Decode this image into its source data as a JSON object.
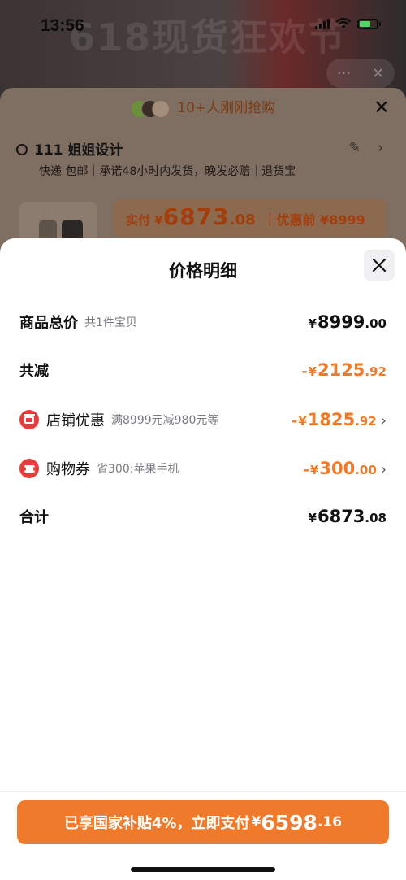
{
  "status_bar": {
    "time": "13:56"
  },
  "background": {
    "banner_text": "618现货狂欢节",
    "capsule_more": "···",
    "capsule_close": "✕",
    "grab_text": "10+人刚刚抢购",
    "close": "✕",
    "address": "111 姐姐设计",
    "delivery": "快递 包邮｜承诺48小时内发货，晚发必赔｜退货宝",
    "paid_label": "实付 ¥",
    "paid_amount": "6873",
    "paid_cents": ".08",
    "before_discount": "｜优惠前 ¥8999"
  },
  "sheet": {
    "title": "价格明细",
    "rows": {
      "total": {
        "label": "商品总价",
        "sub": "共1件宝贝",
        "currency": "¥",
        "amount": "8999",
        "cents": ".00"
      },
      "reduction": {
        "label": "共减",
        "sign": "-",
        "currency": "¥",
        "amount": "2125",
        "cents": ".92"
      },
      "store_discount": {
        "label": "店铺优惠",
        "sub": "满8999元减980元等",
        "sign": "-",
        "currency": "¥",
        "amount": "1825",
        "cents": ".92"
      },
      "shopping_coupon": {
        "label": "购物券",
        "sub": "省300:苹果手机",
        "sign": "-",
        "currency": "¥",
        "amount": "300",
        "cents": ".00"
      },
      "subtotal": {
        "label": "合计",
        "currency": "¥",
        "amount": "6873",
        "cents": ".08"
      }
    }
  },
  "bottom": {
    "pay_text": "已享国家补贴4%，立即支付",
    "currency": "¥",
    "amount": "6598",
    "cents": ".16"
  },
  "colors": {
    "accent": "#ef7a2c",
    "discount_text": "#f07a28",
    "icon_red": "#e63c3c"
  }
}
